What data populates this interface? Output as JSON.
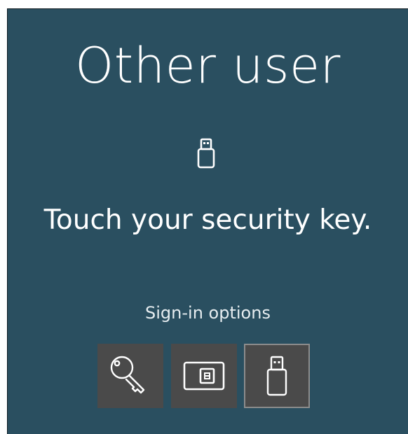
{
  "screen": {
    "title": "Other user",
    "prompt": "Touch your security key.",
    "icon": "usb-security-key-icon",
    "background_color": "#2a4f60"
  },
  "sign_in_options": {
    "label": "Sign-in options",
    "selected": "Security key",
    "options": [
      {
        "icon": "key-icon",
        "kind": "Password"
      },
      {
        "icon": "smart-card-icon",
        "kind": "Smart card"
      },
      {
        "icon": "usb-security-key-icon",
        "kind": "Security key"
      }
    ],
    "tile_color": "#4a4a4a",
    "selected_border_color": "#8c8c8c"
  }
}
